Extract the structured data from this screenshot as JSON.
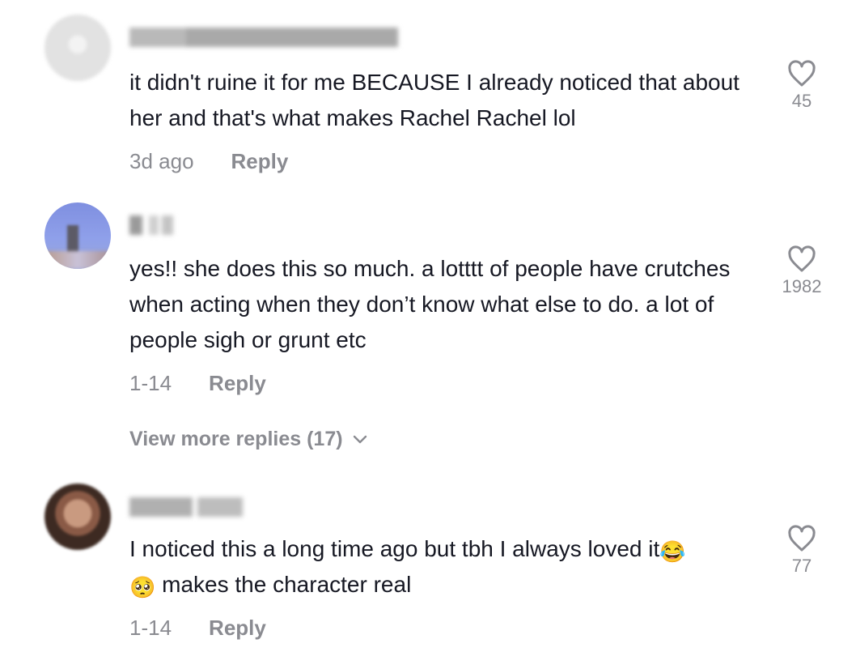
{
  "comments": [
    {
      "username": "user8479825715035",
      "text": "it didn't ruine it for me BECAUSE I already noticed that about her and that's what makes Rachel Rachel lol",
      "time": "3d ago",
      "reply_label": "Reply",
      "likes": "45"
    },
    {
      "username": "g",
      "text": "yes!! she does this so much. a lotttt of people have crutches when acting when they don’t know what else to do. a lot of people sigh or grunt etc",
      "time": "1-14",
      "reply_label": "Reply",
      "likes": "1982"
    },
    {
      "username": "marie.ma",
      "text_before_emoji": "I noticed this a long time ago but tbh I always loved it",
      "emoji_1": "😂",
      "emoji_2": "🥺",
      "text_after_emoji": " makes the character real",
      "time": "1-14",
      "reply_label": "Reply",
      "likes": "77"
    }
  ],
  "view_more_replies": "View more replies (17)",
  "icons": {
    "like": "heart-outline-icon",
    "expand": "chevron-down-icon"
  },
  "colors": {
    "text": "#161823",
    "muted": "#8a8b91",
    "background": "#ffffff"
  }
}
